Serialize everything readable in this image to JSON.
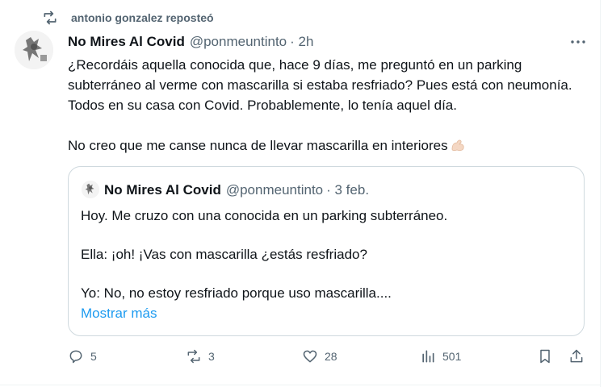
{
  "repost": {
    "text": "antonio gonzalez reposteó"
  },
  "tweet": {
    "name": "No Mires Al Covid",
    "handle": "@ponmeuntinto",
    "time": "· 2h",
    "paragraph1": "¿Recordáis aquella conocida que, hace 9 días, me preguntó en un parking subterráneo al verme con mascarilla si estaba resfriado? Pues está con neumonía. Todos en su casa con Covid. Probablemente, lo tenía aquel día.",
    "paragraph2": "No creo que me canse nunca de llevar mascarilla en interiores",
    "emoji": "flexed-biceps-icon"
  },
  "quote": {
    "name": "No Mires Al Covid",
    "handle": "@ponmeuntinto",
    "time": "· 3 feb.",
    "line1": "Hoy. Me cruzo con una conocida en un parking subterráneo.",
    "line2": "Ella: ¡oh! ¡Vas con mascarilla ¿estás resfriado?",
    "line3": "Yo: No, no estoy resfriado porque uso mascarilla....",
    "show_more": "Mostrar más"
  },
  "actions": {
    "replies": "5",
    "reposts": "3",
    "likes": "28",
    "views": "501"
  },
  "colors": {
    "link": "#1d9bf0",
    "muted": "#536471",
    "text": "#0f1419",
    "border": "#cfd9de"
  }
}
